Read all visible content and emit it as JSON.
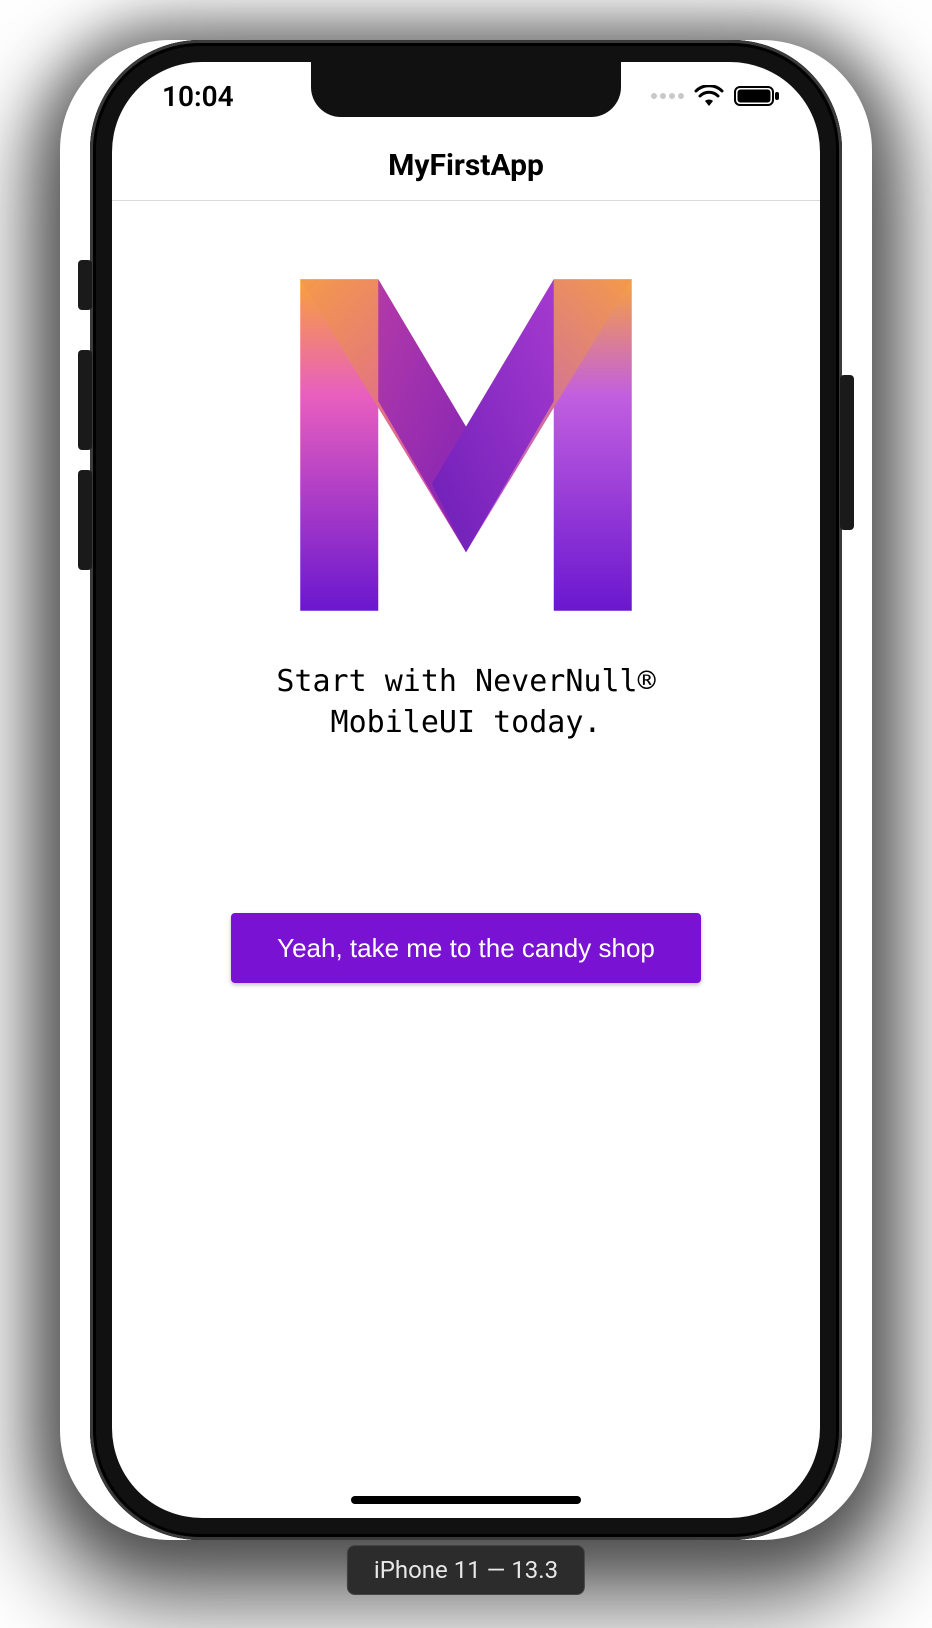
{
  "status": {
    "time": "10:04"
  },
  "nav": {
    "title": "MyFirstApp"
  },
  "main": {
    "tagline": "Start with NeverNull®\nMobileUI today.",
    "cta_label": "Yeah, take me to the candy shop"
  },
  "simulator": {
    "device_label": "iPhone 11 — 13.3"
  },
  "colors": {
    "accent": "#7a12d4"
  }
}
